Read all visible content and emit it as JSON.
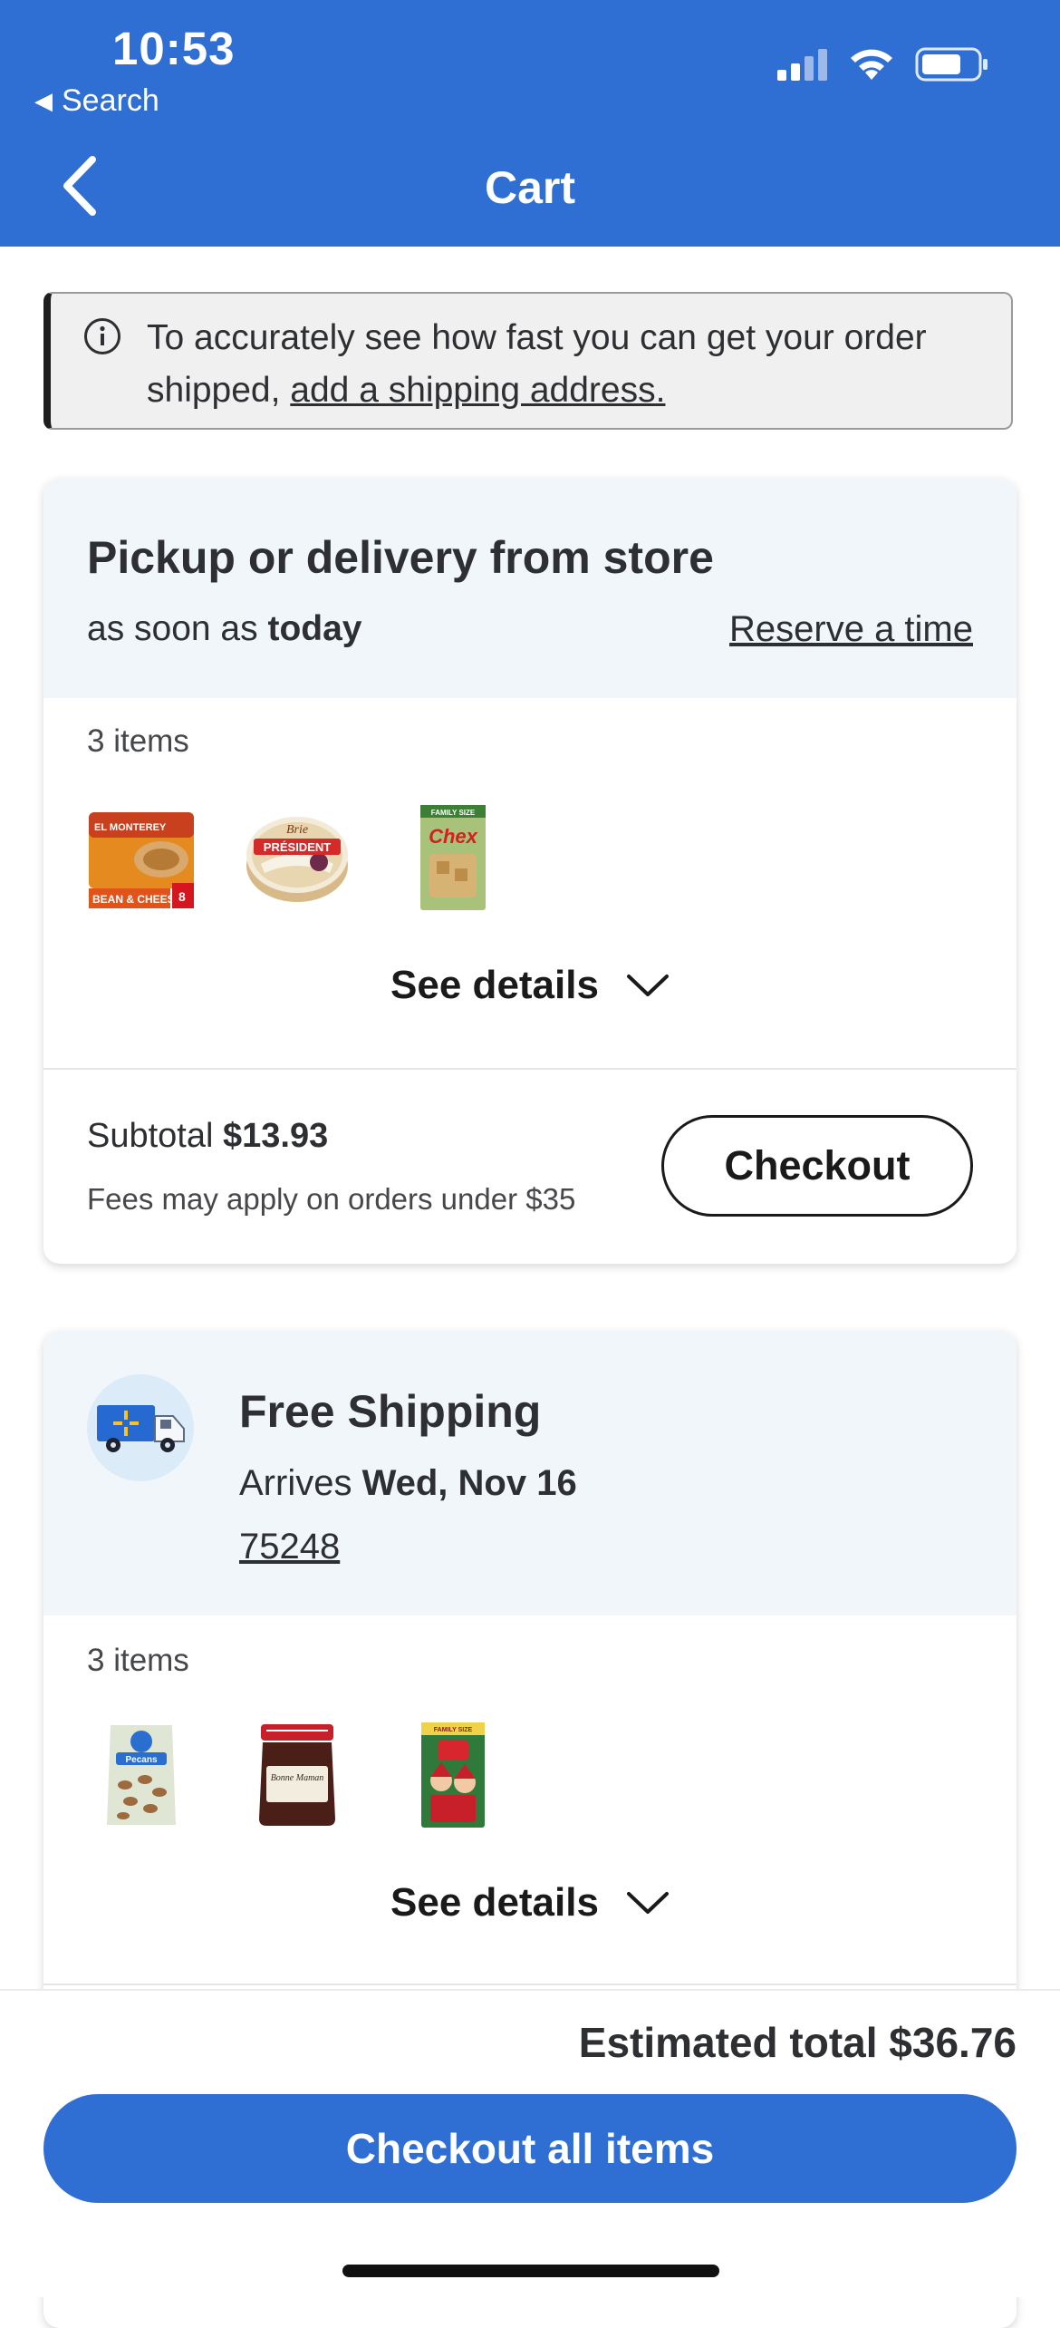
{
  "status_bar": {
    "time": "10:53",
    "back_app": "Search"
  },
  "header": {
    "title": "Cart"
  },
  "banner": {
    "text": "To accurately see how fast you can get your order shipped,",
    "link": "add a shipping address."
  },
  "pickup_card": {
    "title": "Pickup or delivery from store",
    "sub_prefix": "as soon as",
    "sub_emph": "today",
    "reserve_link": "Reserve a time",
    "item_count": "3 items",
    "items": [
      {
        "name": "El Monterey Bean & Cheese Burritos",
        "brand": "EL MONTEREY",
        "tag": "BEAN & CHEESE",
        "pack": "8"
      },
      {
        "name": "Président Brie",
        "brand": "Brie",
        "label": "PRÉSIDENT"
      },
      {
        "name": "Chex Cereal",
        "brand": "Chex",
        "tag": "FAMILY SIZE"
      }
    ],
    "see_details": "See details",
    "subtotal_label": "Subtotal",
    "subtotal_value": "$13.93",
    "fees_note": "Fees may apply on orders under $35",
    "checkout_label": "Checkout"
  },
  "shipping_card": {
    "icon": "delivery-truck-icon",
    "title": "Free Shipping",
    "arrives_prefix": "Arrives",
    "arrives_date": "Wed, Nov 16",
    "zip": "75248",
    "item_count": "3 items",
    "items": [
      {
        "name": "Great Value Pecans",
        "label": "Pecans"
      },
      {
        "name": "Bonne Maman Fig Preserves",
        "label": "Bonne Maman"
      },
      {
        "name": "Elf on the Shelf Cereal",
        "tag": "FAMILY SIZE"
      }
    ],
    "see_details": "See details"
  },
  "footer": {
    "estimated_total": "Estimated total $36.76",
    "checkout_all": "Checkout all items"
  },
  "colors": {
    "brand_blue": "#2f6fd4",
    "card_header_bg": "#f1f6fb",
    "banner_bg": "#f0f0f0",
    "text": "#2e2f32"
  }
}
